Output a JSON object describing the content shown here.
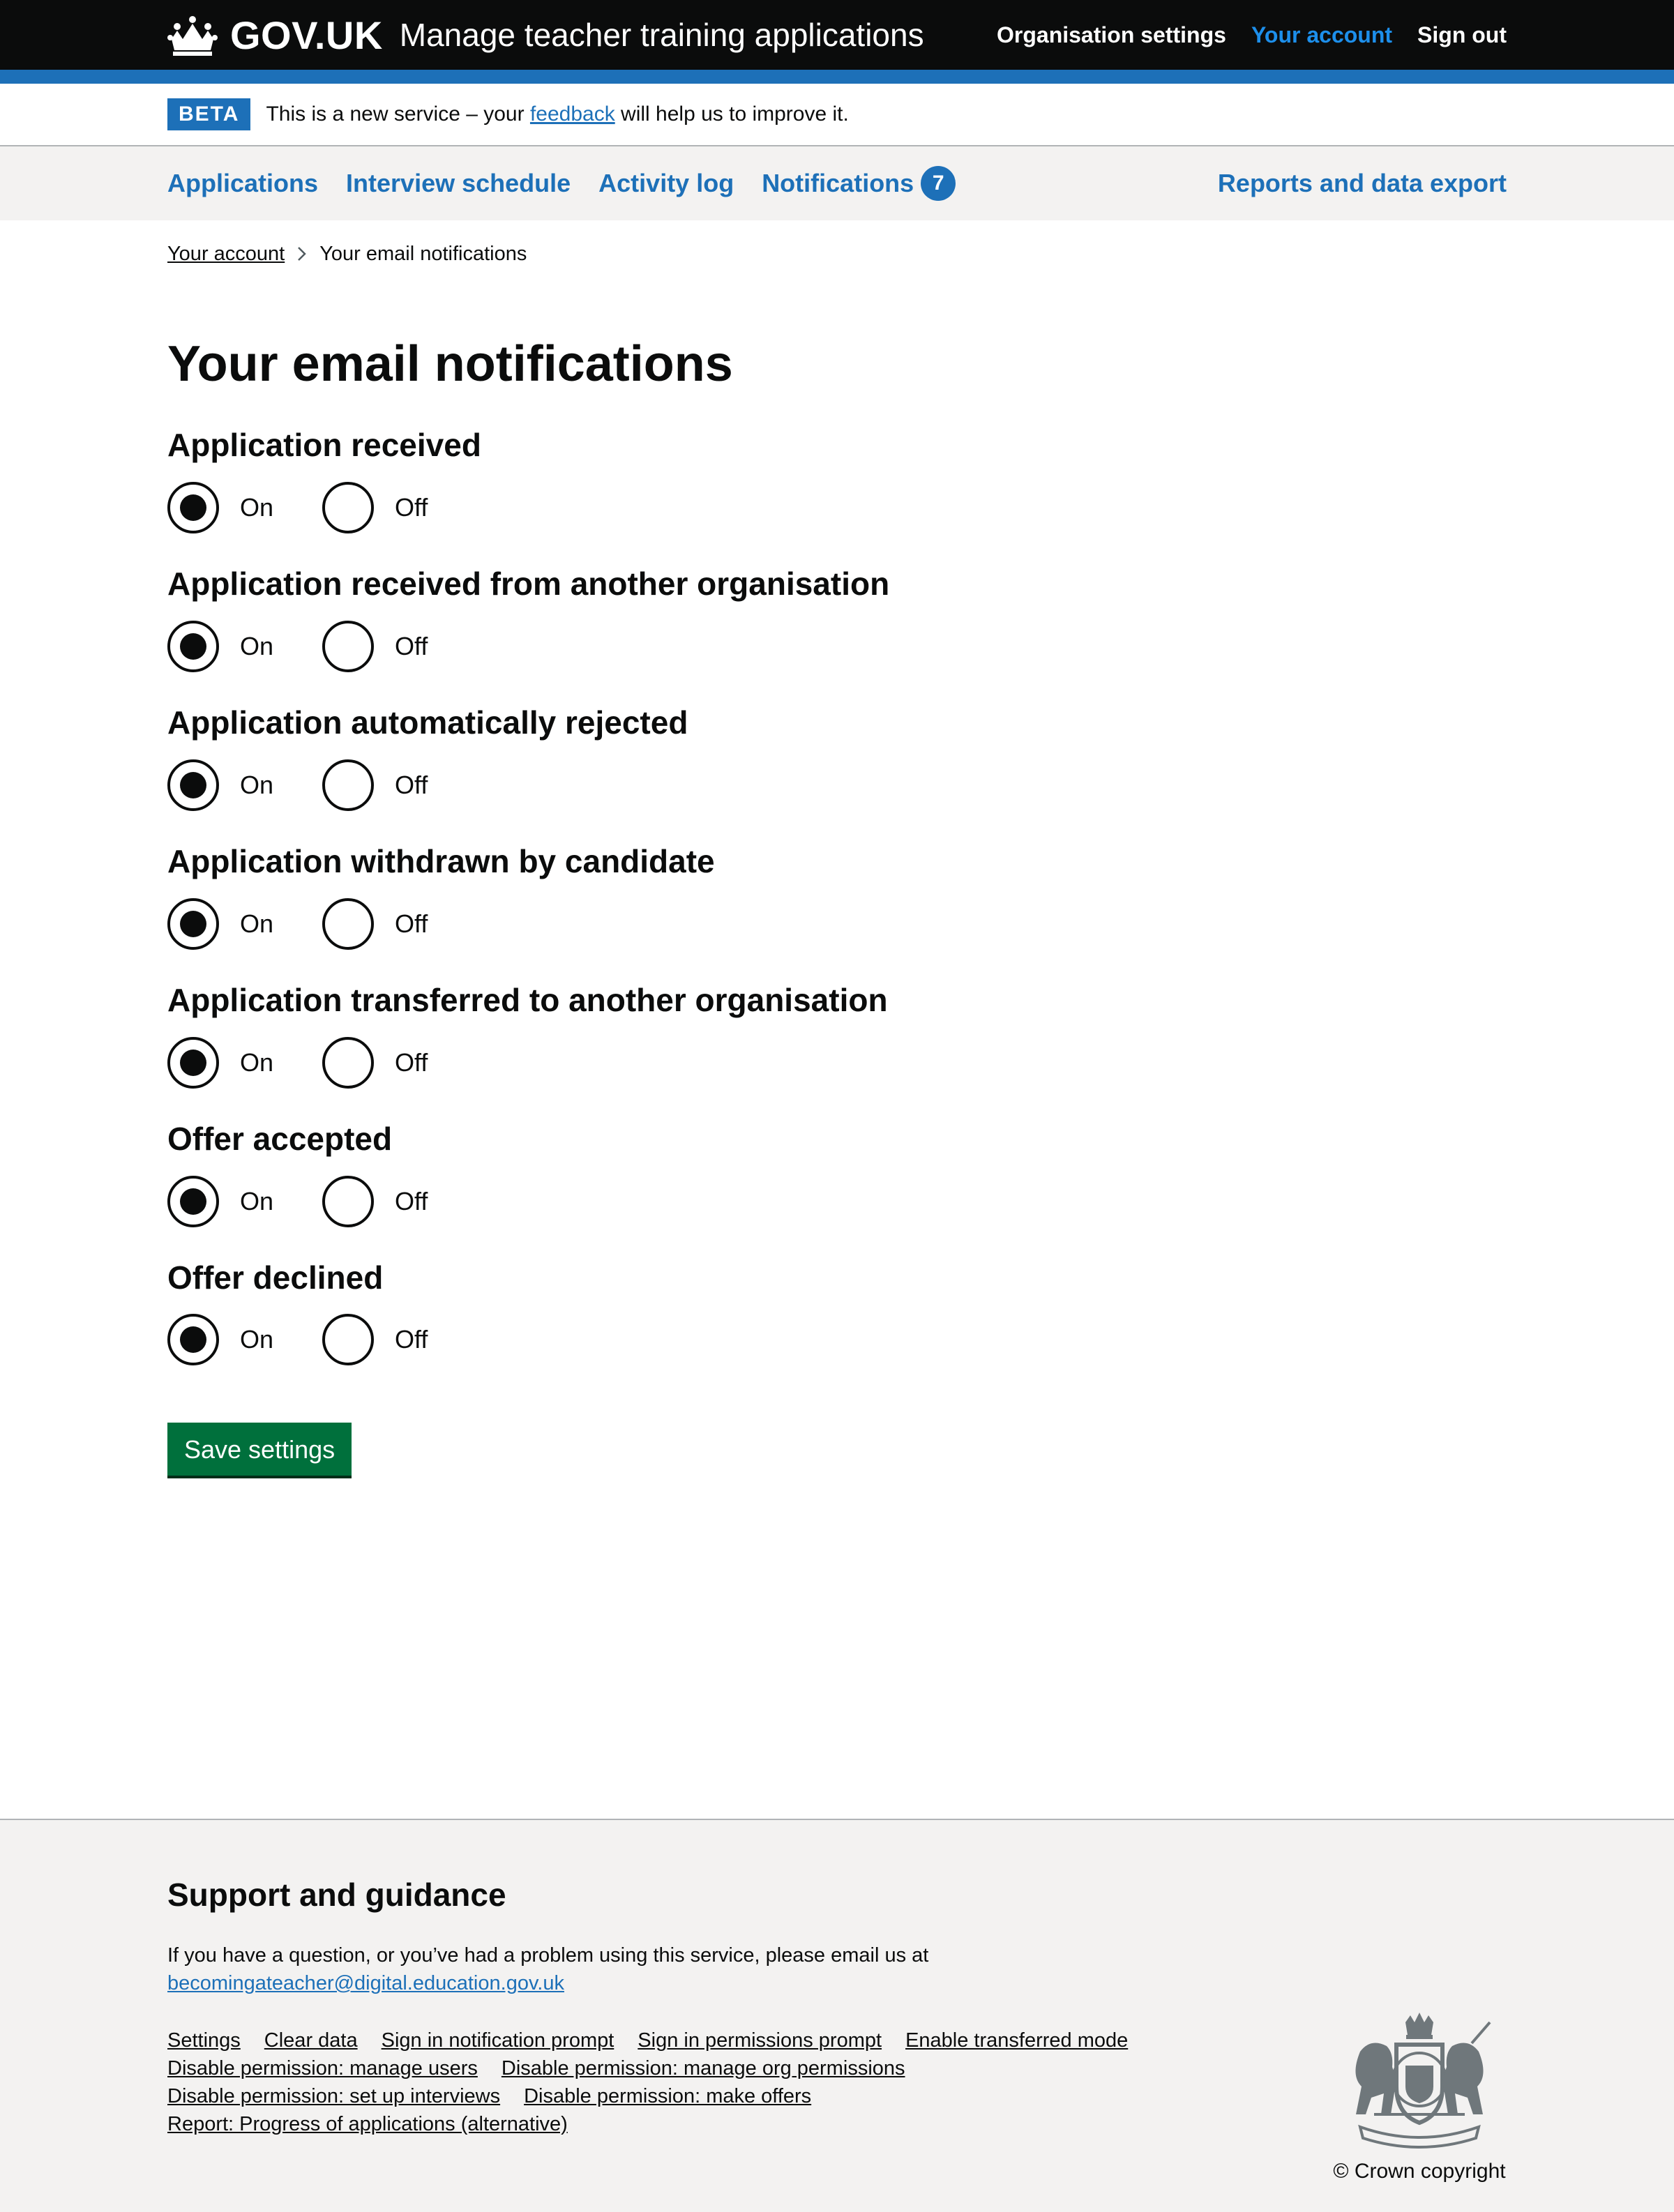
{
  "header": {
    "logo_text": "GOV.UK",
    "service_name": "Manage teacher training applications",
    "nav": [
      "Organisation settings",
      "Your account",
      "Sign out"
    ]
  },
  "beta": {
    "tag": "BETA",
    "text_before": "This is a new service – your ",
    "link": "feedback",
    "text_after": " will help us to improve it."
  },
  "primary_nav": {
    "items": [
      "Applications",
      "Interview schedule",
      "Activity log",
      "Notifications"
    ],
    "notifications_count": "7",
    "right": "Reports and data export"
  },
  "breadcrumb": {
    "parent": "Your account",
    "current": "Your email notifications"
  },
  "page_title": "Your email notifications",
  "option_labels": {
    "on": "On",
    "off": "Off"
  },
  "groups": [
    {
      "title": "Application received",
      "selected": "on"
    },
    {
      "title": "Application received from another organisation",
      "selected": "on"
    },
    {
      "title": "Application automatically rejected",
      "selected": "on"
    },
    {
      "title": "Application withdrawn by candidate",
      "selected": "on"
    },
    {
      "title": "Application transferred to another organisation",
      "selected": "on"
    },
    {
      "title": "Offer accepted",
      "selected": "on"
    },
    {
      "title": "Offer declined",
      "selected": "on"
    }
  ],
  "save_button": "Save settings",
  "footer": {
    "heading": "Support and guidance",
    "text": "If you have a question, or you’ve had a problem using this service, please email us at",
    "email": "becomingateacher@digital.education.gov.uk",
    "links": [
      "Settings",
      "Clear data",
      "Sign in notification prompt",
      "Sign in permissions prompt",
      "Enable transferred mode",
      "Disable permission: manage users",
      "Disable permission: manage org permissions",
      "Disable permission: set up interviews",
      "Disable permission: make offers",
      "Report: Progress of applications (alternative)"
    ],
    "copyright": "© Crown copyright"
  },
  "colors": {
    "header_bg": "#0b0c0c",
    "brand_blue": "#1d70b8",
    "active_link": "#1d8feb",
    "button_green": "#00703c",
    "footer_bg": "#f3f2f1"
  }
}
